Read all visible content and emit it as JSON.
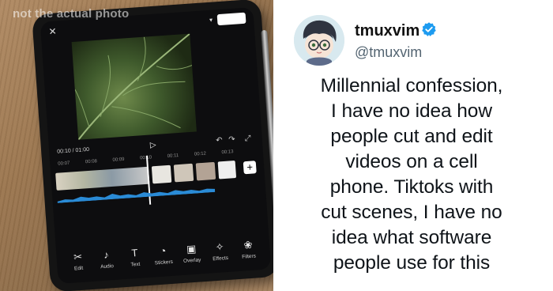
{
  "photo": {
    "watermark": "not the actual photo",
    "editor": {
      "time_display": "00:10 / 01:00",
      "ruler_ticks": [
        "00:07",
        "00:08",
        "00:09",
        "00:10",
        "00:11",
        "00:12",
        "00:13"
      ],
      "toolbar": [
        {
          "icon": "scissors-icon",
          "label": "Edit"
        },
        {
          "icon": "music-note-icon",
          "label": "Audio"
        },
        {
          "icon": "text-icon",
          "label": "Text"
        },
        {
          "icon": "sticker-icon",
          "label": "Stickers"
        },
        {
          "icon": "overlay-icon",
          "label": "Overlay"
        },
        {
          "icon": "sparkle-icon",
          "label": "Effects"
        },
        {
          "icon": "filters-icon",
          "label": "Filters"
        }
      ]
    }
  },
  "tweet": {
    "display_name": "tmuxvim",
    "handle": "@tmuxvim",
    "verified": true,
    "text_lines": [
      "Millennial confession,",
      "I have no idea how",
      "people cut and edit",
      "videos on a cell",
      "phone. Tiktoks with",
      "cut scenes, I have no",
      "idea what software",
      "people use for this"
    ]
  },
  "colors": {
    "verified_badge": "#1d9bf0",
    "handle_gray": "#536471",
    "text_dark": "#0f1419"
  }
}
